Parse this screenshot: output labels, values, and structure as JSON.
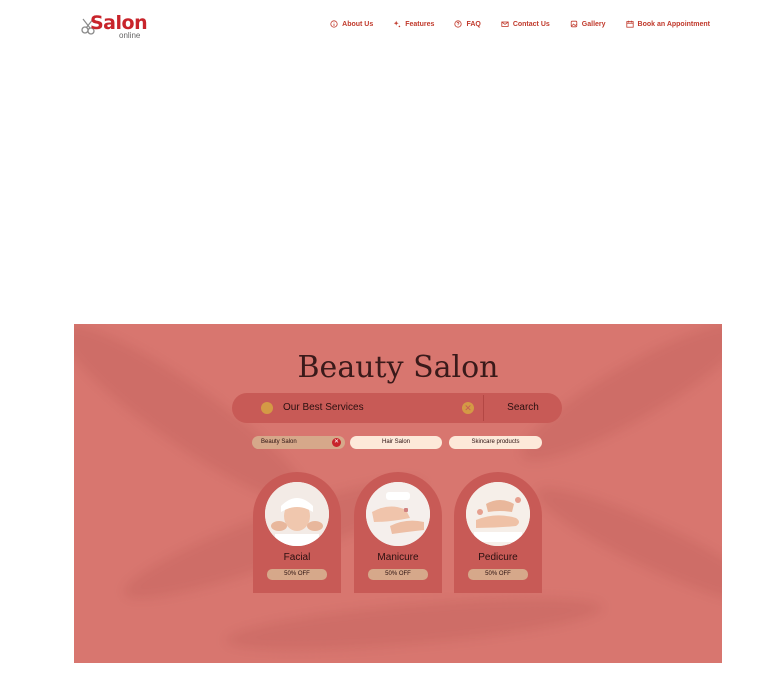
{
  "logo": {
    "word": "Salon",
    "sub": "online"
  },
  "nav": [
    {
      "label": "About Us",
      "icon": "info-icon"
    },
    {
      "label": "Features",
      "icon": "sparkle-icon"
    },
    {
      "label": "FAQ",
      "icon": "question-icon"
    },
    {
      "label": "Contact Us",
      "icon": "mail-icon"
    },
    {
      "label": "Gallery",
      "icon": "gallery-icon"
    },
    {
      "label": "Book an Appointment",
      "icon": "calendar-icon"
    }
  ],
  "banner": {
    "title": "Beauty Salon",
    "search": {
      "text": "Our Best Services",
      "button": "Search"
    },
    "chips": [
      "Beauty Salon",
      "Hair Salon",
      "Skincare products"
    ],
    "cards": [
      {
        "name": "Facial",
        "badge": "50% OFF"
      },
      {
        "name": "Manicure",
        "badge": "50% OFF"
      },
      {
        "name": "Pedicure",
        "badge": "50% OFF"
      }
    ]
  },
  "colors": {
    "brand": "#c8242b",
    "nav": "#c0392b",
    "banner": "#d8766f",
    "accent": "#d49a45"
  }
}
